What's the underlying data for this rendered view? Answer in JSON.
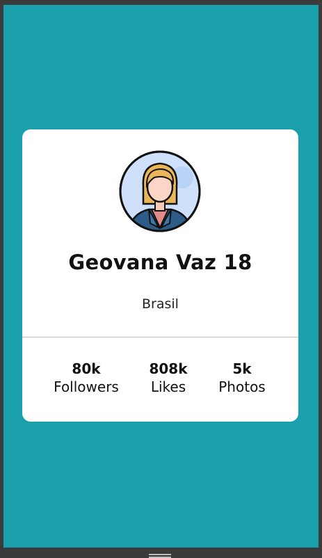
{
  "profile": {
    "name": "Geovana Vaz 18",
    "country": "Brasil"
  },
  "stats": [
    {
      "value": "80k",
      "label": "Followers"
    },
    {
      "value": "808k",
      "label": "Likes"
    },
    {
      "value": "5k",
      "label": "Photos"
    }
  ],
  "colors": {
    "background": "#1aa0ad",
    "card": "#ffffff"
  }
}
